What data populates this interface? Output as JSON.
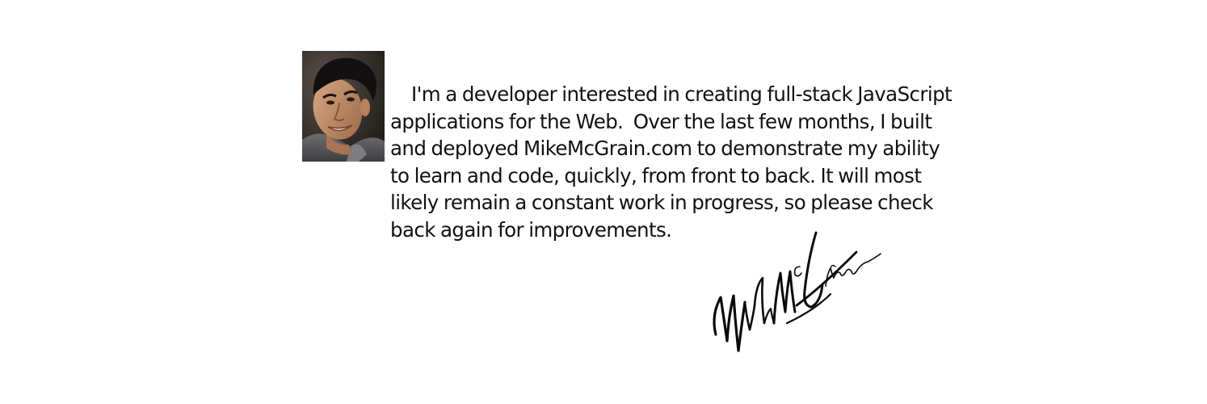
{
  "about": {
    "photo_icon": "portrait-photo",
    "bio_lines": [
      "I'm a developer interested in creating full-stack JavaScript",
      "applications for the Web.  Over the last few months, I built",
      "and deployed MikeMcGrain.com to demonstrate my ability",
      "to learn and code, quickly, from front to back. It will most",
      "likely remain a constant work in progress, so please check",
      "back again for improvements."
    ],
    "signature_text": "Mike McGrain"
  }
}
